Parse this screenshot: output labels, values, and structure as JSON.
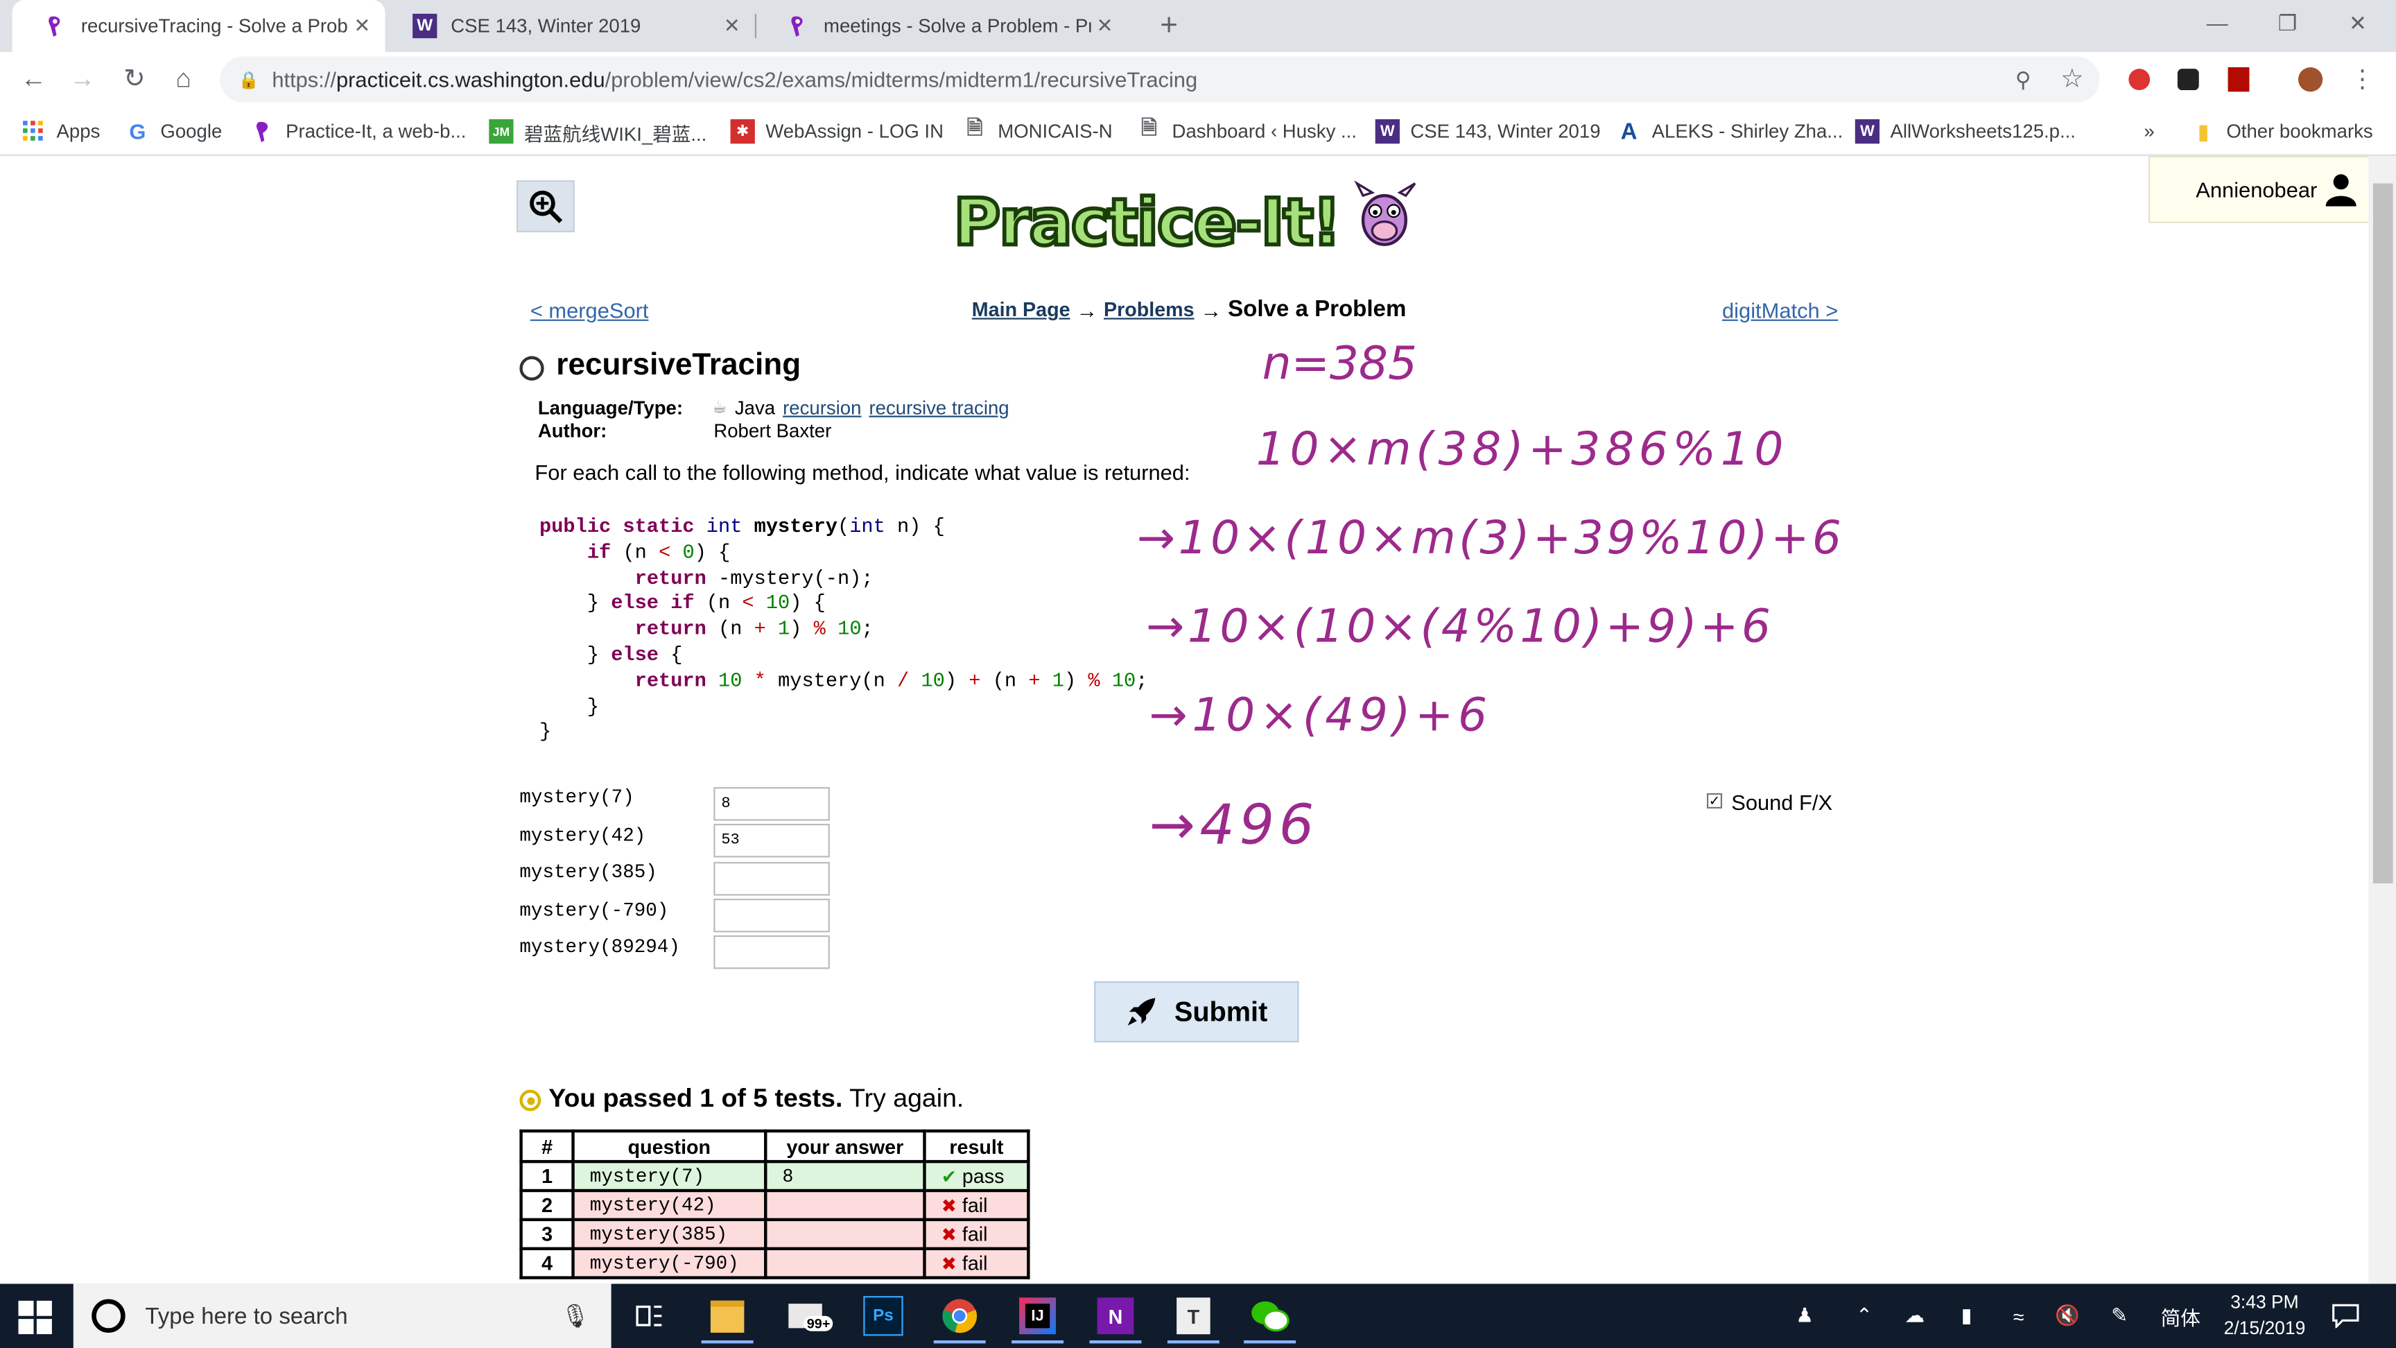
{
  "browser": {
    "tabs": [
      {
        "title": "recursiveTracing - Solve a Proble",
        "active": true
      },
      {
        "title": "CSE 143, Winter 2019",
        "active": false
      },
      {
        "title": "meetings - Solve a Problem - Pra",
        "active": false
      }
    ],
    "new_tab_glyph": "+",
    "close_glyph": "✕",
    "url": {
      "scheme": "https://",
      "host": "practiceit.cs.washington.edu",
      "path": "/problem/view/cs2/exams/midterms/midterm1/recursiveTracing"
    },
    "bookmarks": [
      "Apps",
      "Google",
      "Practice-It, a web-b...",
      "碧蓝航线WIKI_碧蓝...",
      "WebAssign - LOG IN",
      "MONICAIS-N",
      "Dashboard ‹ Husky ...",
      "CSE 143, Winter 2019",
      "ALEKS - Shirley Zha...",
      "AllWorksheets125.p..."
    ],
    "bookmarks_overflow": "»",
    "other_bookmarks": "Other bookmarks",
    "colors": {
      "tab_strip": "#dee1e6",
      "purple_icon": "#8a1fc1",
      "uw_purple": "#4b2e83"
    }
  },
  "page": {
    "logo_text": "Practice-It!",
    "user": "Annienobear",
    "nav": {
      "prev": "< mergeSort",
      "main": "Main Page",
      "arrow": "→",
      "problems": "Problems",
      "current": "Solve a Problem",
      "next": "digitMatch >"
    },
    "problem": {
      "title": "recursiveTracing",
      "language_label": "Language/Type:",
      "language": "Java",
      "tags": [
        "recursion",
        "recursive tracing"
      ],
      "author_label": "Author:",
      "author": "Robert Baxter",
      "prompt": "For each call to the following method, indicate what value is returned:"
    },
    "questions": [
      {
        "call": "mystery(7)",
        "answer": "8"
      },
      {
        "call": "mystery(42)",
        "answer": "53"
      },
      {
        "call": "mystery(385)",
        "answer": ""
      },
      {
        "call": "mystery(-790)",
        "answer": ""
      },
      {
        "call": "mystery(89294)",
        "answer": ""
      }
    ],
    "sound_label": "Sound F/X",
    "submit_label": "Submit",
    "result": {
      "bold": "You passed 1 of 5 tests.",
      "rest": "Try again."
    },
    "table": {
      "headers": [
        "#",
        "question",
        "your answer",
        "result"
      ],
      "rows": [
        {
          "n": "1",
          "q": "mystery(7)",
          "a": "8",
          "r": "pass"
        },
        {
          "n": "2",
          "q": "mystery(42)",
          "a": "",
          "r": "fail"
        },
        {
          "n": "3",
          "q": "mystery(385)",
          "a": "",
          "r": "fail"
        },
        {
          "n": "4",
          "q": "mystery(-790)",
          "a": "",
          "r": "fail"
        }
      ]
    },
    "handwriting": [
      "n=385",
      "10×m(38)+386%10",
      "→10×(10×m(3)+39%10)+6",
      "→10×(10×(4%10)+9)+6",
      "→10×(49)+6",
      "→496"
    ]
  },
  "taskbar": {
    "search_placeholder": "Type here to search",
    "mail_badge": "99+",
    "ime": "简体",
    "time": "3:43 PM",
    "date": "2/15/2019"
  }
}
